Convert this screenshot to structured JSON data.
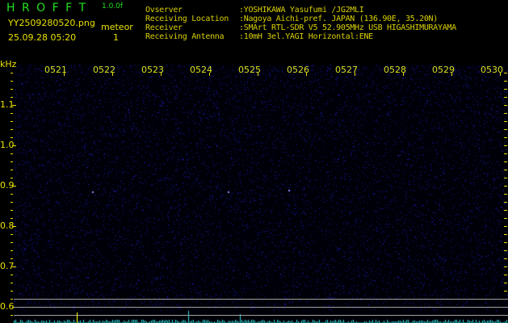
{
  "header": {
    "app_name": "H R O F F T",
    "version": "1.0.0f",
    "filename": "YY2509280520.png",
    "datetime": "25.09.28 05:20",
    "mode_label": "meteor",
    "count": "1"
  },
  "station_info": [
    {
      "label": "Ovserver",
      "value": ":YOSHIKAWA Yasufumi /JG2MLI"
    },
    {
      "label": "Receiving Location",
      "value": ":Nagoya Aichi-pref. JAPAN (136.90E, 35.20N)"
    },
    {
      "label": "Receiver",
      "value": ":SMArt RTL-SDR V5 52.905MHz USB HIGASHIMURAYAMA"
    },
    {
      "label": "Receiving Antenna",
      "value": ":10mH 3el.YAGI Horizontal:ENE"
    }
  ],
  "spectrogram": {
    "y_unit": "kHz",
    "y_ticks": [
      "1.1",
      "1.0",
      "0.9",
      "0.8",
      "0.7",
      "0.6"
    ],
    "time_labels": [
      "0521",
      "0522",
      "0523",
      "0524",
      "0525",
      "0526",
      "0527",
      "0528",
      "0529",
      "0530"
    ],
    "colors": {
      "noise": "#1a1aa0",
      "labels": "#e8e000",
      "spectrum": "#30e0e0",
      "title": "#22e022"
    }
  }
}
